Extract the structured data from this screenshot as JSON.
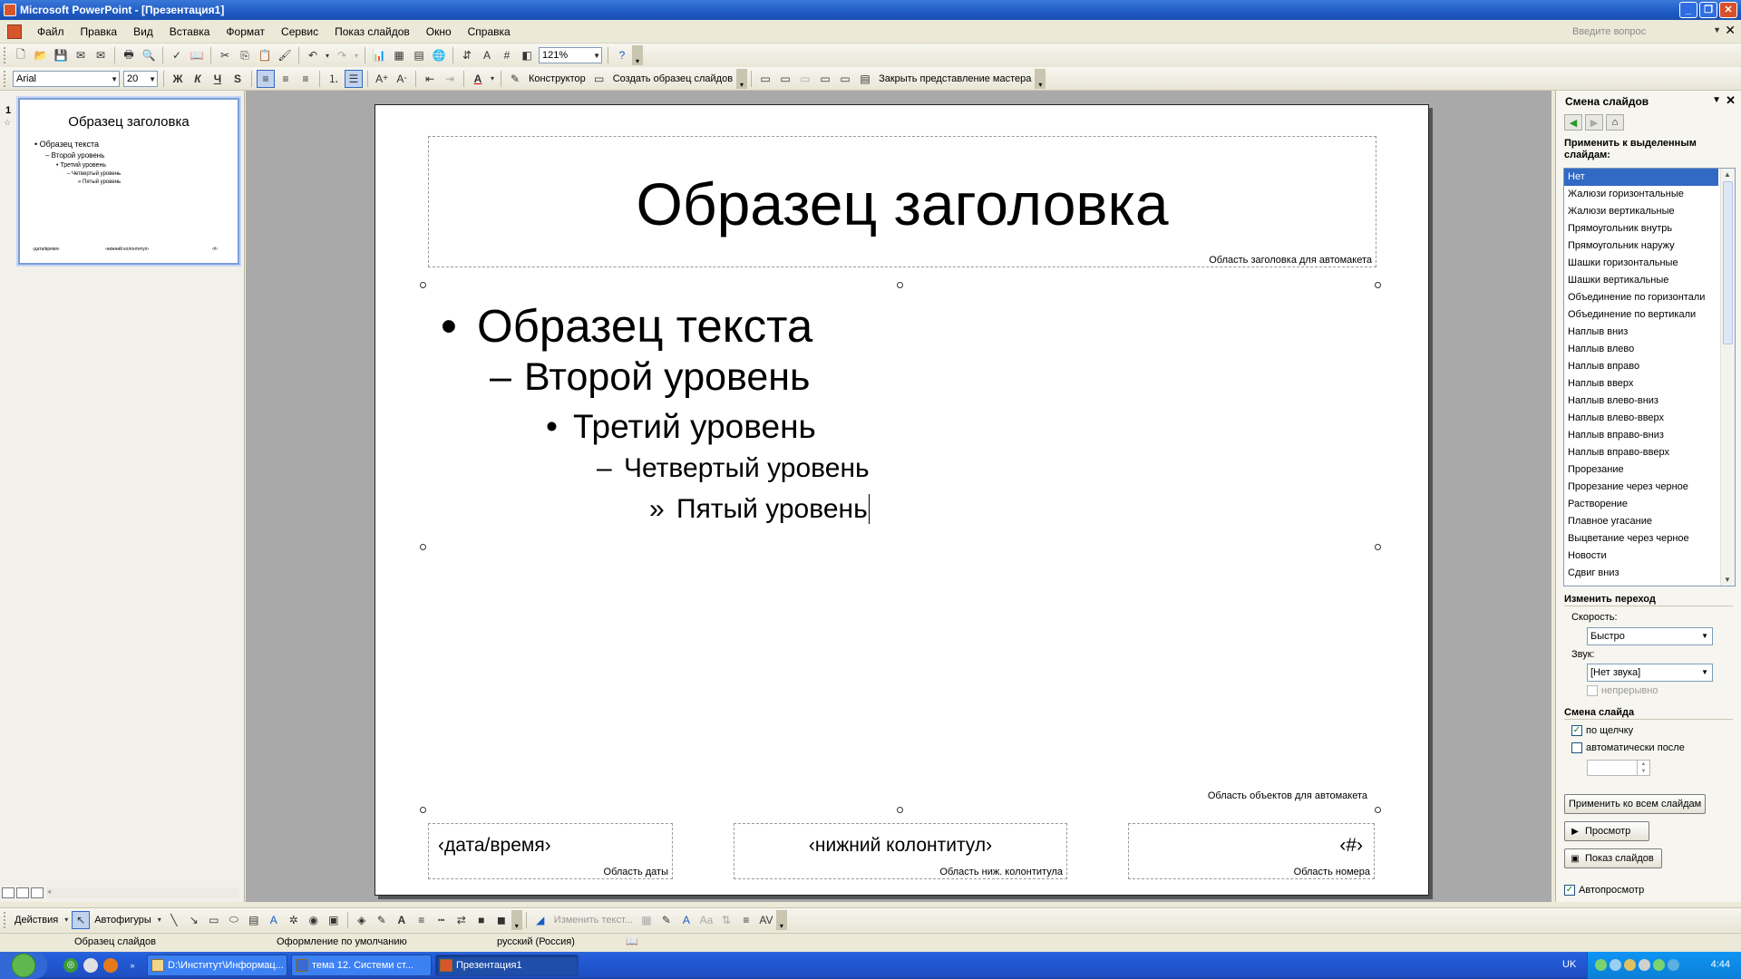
{
  "window": {
    "title": "Microsoft PowerPoint - [Презентация1]"
  },
  "menu": {
    "items": [
      "Файл",
      "Правка",
      "Вид",
      "Вставка",
      "Формат",
      "Сервис",
      "Показ слайдов",
      "Окно",
      "Справка"
    ],
    "ask_placeholder": "Введите вопрос"
  },
  "toolbar": {
    "zoom": "121%",
    "font": "Arial",
    "font_size": "20",
    "bold": "Ж",
    "italic": "К",
    "underline": "Ч",
    "shadow": "S",
    "designer": "Конструктор",
    "create_master": "Создать образец слайдов",
    "close_master": "Закрыть представление мастера"
  },
  "thumbnail": {
    "number": "1",
    "title": "Образец заголовка",
    "levels": [
      "• Образец текста",
      "– Второй уровень",
      "• Третий уровень",
      "– Четвертый уровень",
      "» Пятый уровень"
    ],
    "footer_date": "‹дата/время›",
    "footer_text": "‹нижний колонтитул›",
    "footer_num": "‹#›"
  },
  "slide": {
    "title": "Образец заголовка",
    "title_area_label": "Область заголовка для автомакета",
    "levels": [
      {
        "bullet": "•",
        "text": "Образец текста"
      },
      {
        "bullet": "–",
        "text": "Второй уровень"
      },
      {
        "bullet": "•",
        "text": "Третий уровень"
      },
      {
        "bullet": "–",
        "text": "Четвертый уровень"
      },
      {
        "bullet": "»",
        "text": "Пятый уровень"
      }
    ],
    "body_area_label": "Область объектов для автомакета",
    "date_text": "‹дата/время›",
    "date_area_label": "Область даты",
    "footer_text": "‹нижний колонтитул›",
    "footer_area_label": "Область ниж. колонтитула",
    "number_text": "‹#›",
    "number_area_label": "Область номера"
  },
  "taskpane": {
    "title": "Смена слайдов",
    "apply_label_1": "Применить к выделенным",
    "apply_label_2": "слайдам:",
    "transitions": [
      "Нет",
      "Жалюзи горизонтальные",
      "Жалюзи вертикальные",
      "Прямоугольник внутрь",
      "Прямоугольник наружу",
      "Шашки горизонтальные",
      "Шашки вертикальные",
      "Объединение по горизонтали",
      "Объединение по вертикали",
      "Наплыв вниз",
      "Наплыв влево",
      "Наплыв вправо",
      "Наплыв вверх",
      "Наплыв влево-вниз",
      "Наплыв влево-вверх",
      "Наплыв вправо-вниз",
      "Наплыв вправо-вверх",
      "Прорезание",
      "Прорезание через черное",
      "Растворение",
      "Плавное угасание",
      "Выцветание через черное",
      "Новости",
      "Сдвиг вниз"
    ],
    "selected_transition": "Нет",
    "modify_label": "Изменить переход",
    "speed_label": "Скорость:",
    "speed_value": "Быстро",
    "sound_label": "Звук:",
    "sound_value": "[Нет звука]",
    "loop_label": "непрерывно",
    "advance_label": "Смена слайда",
    "on_click_label": "по щелчку",
    "on_click_checked": true,
    "auto_label": "автоматически после",
    "auto_checked": false,
    "apply_all_button": "Применить ко всем слайдам",
    "preview_button": "Просмотр",
    "slideshow_button": "Показ слайдов",
    "autopreview_label": "Автопросмотр",
    "autopreview_checked": true
  },
  "drawing": {
    "actions": "Действия",
    "autoshapes": "Автофигуры",
    "edit_text": "Изменить текст..."
  },
  "status": {
    "view": "Образец слайдов",
    "design": "Оформление по умолчанию",
    "language": "русский (Россия)"
  },
  "taskbar": {
    "tasks": [
      "D:\\Институт\\Информац...",
      "тема 12. Системи ст...",
      "Презентация1"
    ],
    "lang": "UK",
    "clock": "4:44"
  }
}
